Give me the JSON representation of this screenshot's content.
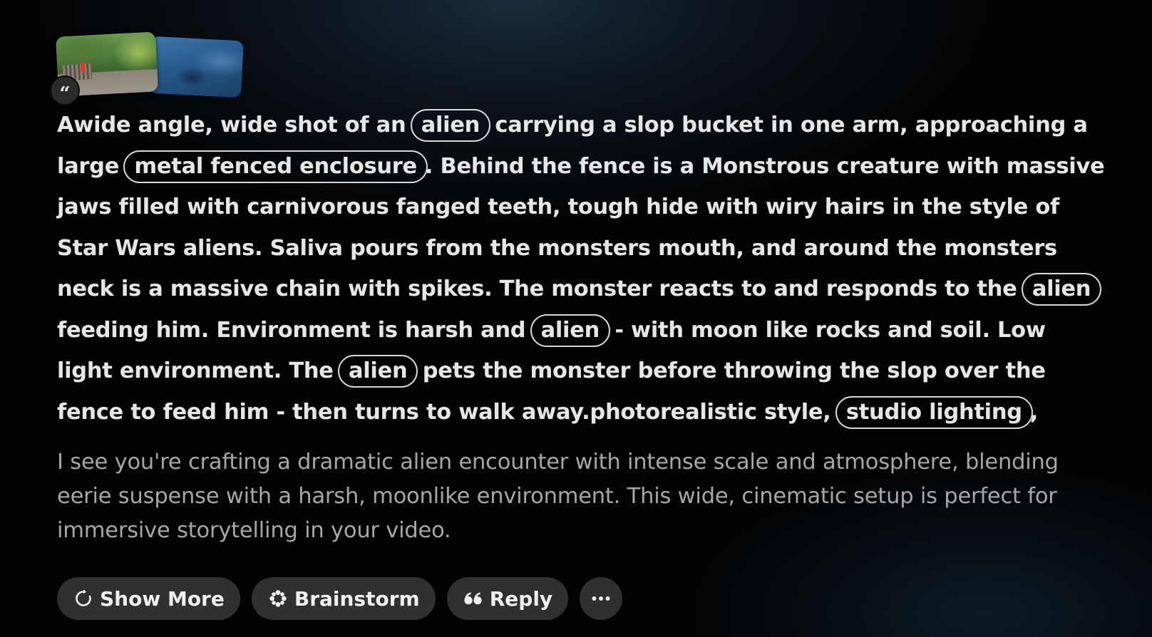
{
  "attachments": {
    "thumbnails": [
      {
        "icon": "photo-thumbnail-forest-fence"
      },
      {
        "icon": "photo-thumbnail-blue-rocks"
      }
    ],
    "badge_glyph": "“"
  },
  "prompt": {
    "segments": [
      {
        "text": "Awide angle, wide shot of an "
      },
      {
        "tag": "alien"
      },
      {
        "text": " carrying a slop bucket in one arm, approaching a large "
      },
      {
        "tag": "metal fenced enclosure"
      },
      {
        "text": ". Behind the fence is a Monstrous creature with massive jaws filled with carnivorous fanged teeth, tough hide with wiry hairs in the style of Star Wars aliens. Saliva pours from the monsters mouth, and around the monsters neck is a massive chain with spikes. The monster reacts to and responds to the "
      },
      {
        "tag": "alien"
      },
      {
        "text": " feeding him. Environment is harsh and "
      },
      {
        "tag": "alien"
      },
      {
        "text": " - with moon like rocks and soil. Low light environment. The "
      },
      {
        "tag": "alien"
      },
      {
        "text": " pets the monster before throwing the slop over the fence to feed him - then turns to walk away.photorealistic style, "
      },
      {
        "tag": "studio lighting"
      },
      {
        "text": ","
      }
    ]
  },
  "response": {
    "text": "I see you're crafting a dramatic alien encounter with intense scale and atmosphere, blending eerie suspense with a harsh, moonlike environment. This wide, cinematic setup is perfect for immersive storytelling in your video."
  },
  "actions": {
    "show_more": {
      "label": "Show More",
      "icon": "refresh-icon"
    },
    "brainstorm": {
      "label": "Brainstorm",
      "icon": "brainstorm-icon"
    },
    "reply": {
      "label": "Reply",
      "icon": "quote-icon"
    },
    "more": {
      "icon": "more-dots-icon"
    }
  }
}
